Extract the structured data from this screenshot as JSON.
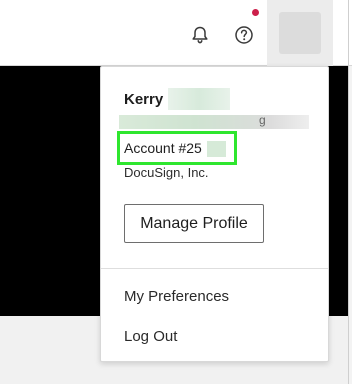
{
  "header": {
    "notification_icon": "bell-icon",
    "help_icon": "question-circle-icon",
    "notification_dot_color": "#cc1f4a"
  },
  "profile_menu": {
    "first_name": "Kerry",
    "email_visible_fragment": "g",
    "account_label": "Account #25",
    "organization": "DocuSign, Inc.",
    "manage_profile_label": "Manage Profile",
    "items": [
      {
        "label": "My Preferences"
      },
      {
        "label": "Log Out"
      }
    ],
    "highlight_color": "#2ee62e"
  }
}
